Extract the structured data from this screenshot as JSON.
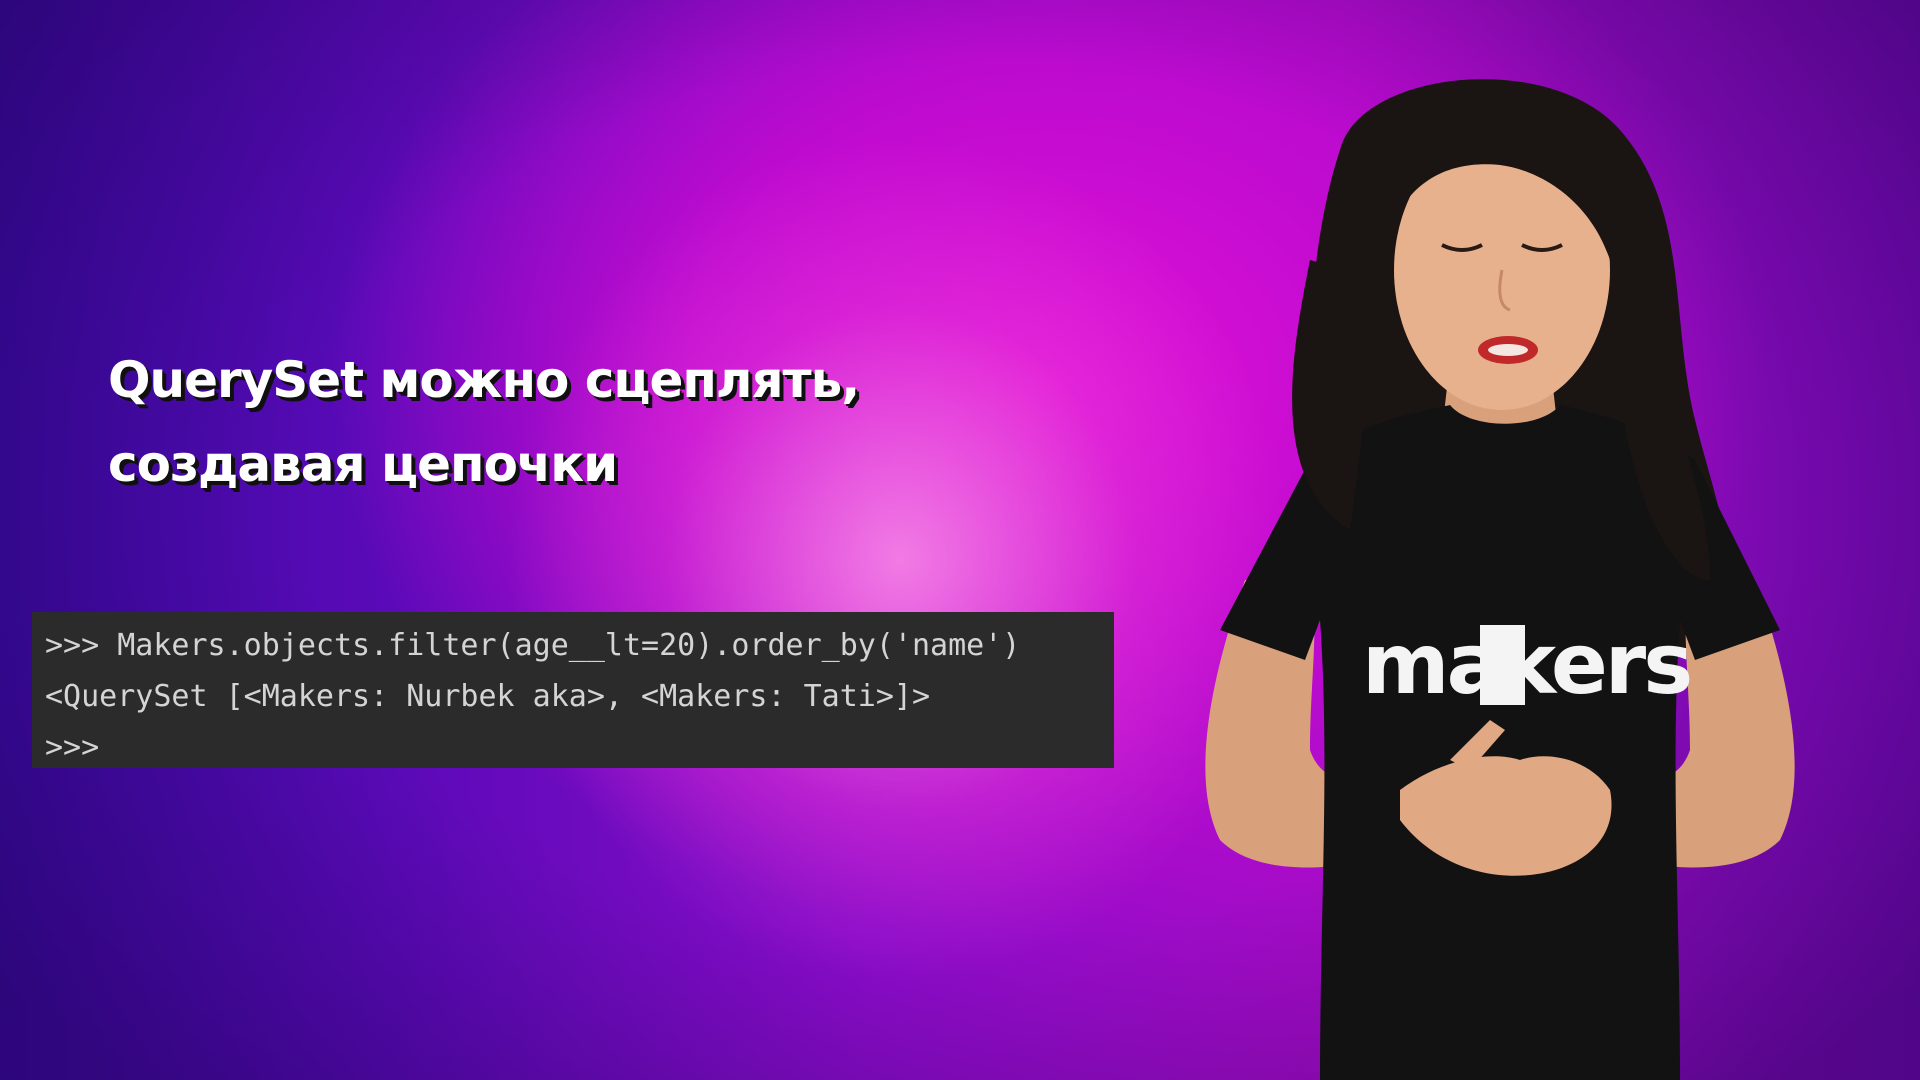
{
  "headline": {
    "line1": "QuerySet можно сцеплять,",
    "line2": "создавая цепочки"
  },
  "console": {
    "lines": [
      ">>> Makers.objects.filter(age__lt=20).order_by('name')",
      "<QuerySet [<Makers: Nurbek aka>, <Makers: Tati>]>",
      ">>>"
    ]
  },
  "presenter": {
    "shirt_text": "makers"
  },
  "colors": {
    "background_center": "#e012d6",
    "background_edge": "#3a0aa0",
    "console_background": "#2b2b2b",
    "console_text": "#d4d4d4",
    "headline_text": "#ffffff"
  }
}
